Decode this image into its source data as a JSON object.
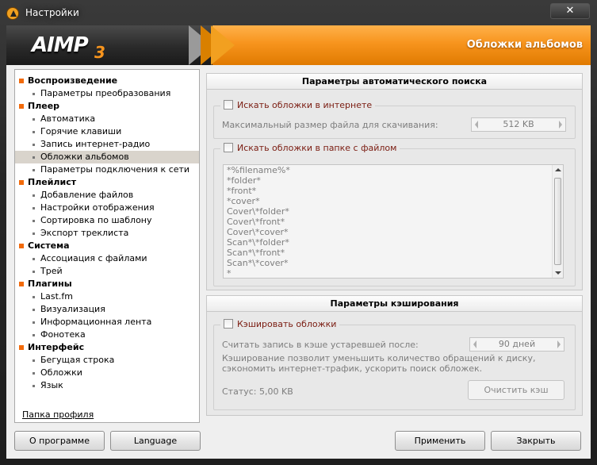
{
  "window": {
    "title": "Настройки",
    "close_glyph": "✕"
  },
  "banner": {
    "logo": "AIMP",
    "logo_version": "3",
    "section_title": "Обложки альбомов"
  },
  "tree": {
    "categories": [
      {
        "label": "Воспроизведение",
        "items": [
          "Параметры преобразования"
        ]
      },
      {
        "label": "Плеер",
        "items": [
          "Автоматика",
          "Горячие клавиши",
          "Запись интернет-радио",
          "Обложки альбомов",
          "Параметры подключения к сети"
        ]
      },
      {
        "label": "Плейлист",
        "items": [
          "Добавление файлов",
          "Настройки отображения",
          "Сортировка по шаблону",
          "Экспорт треклиста"
        ]
      },
      {
        "label": "Система",
        "items": [
          "Ассоциация с файлами",
          "Трей"
        ]
      },
      {
        "label": "Плагины",
        "items": [
          "Last.fm",
          "Визуализация",
          "Информационная лента",
          "Фонотека"
        ]
      },
      {
        "label": "Интерфейс",
        "items": [
          "Бегущая строка",
          "Обложки",
          "Язык"
        ]
      }
    ],
    "selected": "Обложки альбомов",
    "profile_link": "Папка профиля"
  },
  "search": {
    "header": "Параметры автоматического поиска",
    "internet_checkbox": "Искать обложки в интернете",
    "max_size_label": "Максимальный размер файла для скачивания:",
    "max_size_value": "512 KB",
    "folder_checkbox": "Искать обложки в папке с файлом",
    "masks": [
      "*%filename%*",
      "*folder*",
      "*front*",
      "*cover*",
      "Cover\\*folder*",
      "Cover\\*front*",
      "Cover\\*cover*",
      "Scan*\\*folder*",
      "Scan*\\*front*",
      "Scan*\\*cover*",
      "*"
    ]
  },
  "cache": {
    "header": "Параметры кэширования",
    "cache_checkbox": "Кэшировать обложки",
    "expire_label": "Считать запись в кэше устаревшей после:",
    "expire_value": "90 дней",
    "description": "Кэширование позволит уменьшить количество обращений к диску, сэкономить интернет-трафик, ускорить поиск обложек.",
    "status": "Статус:  5,00 KB",
    "clear_button": "Очистить кэш"
  },
  "footer": {
    "about_button": "О программе",
    "language_button": "Language",
    "apply_button": "Применить",
    "close_button": "Закрыть"
  },
  "colors": {
    "accent": "#f7941d",
    "category_bullet": "#f26a0a",
    "checkbox_label": "#7a1b10"
  }
}
